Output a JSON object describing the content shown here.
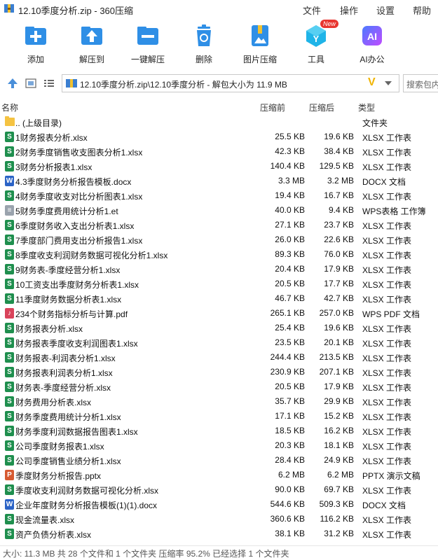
{
  "window": {
    "title": "12.10季度分析.zip - 360压缩",
    "menus": [
      "文件",
      "操作",
      "设置",
      "帮助"
    ]
  },
  "toolbar": {
    "items": [
      {
        "label": "添加",
        "icon": "add-icon"
      },
      {
        "label": "解压到",
        "icon": "extract-to-icon"
      },
      {
        "label": "一键解压",
        "icon": "one-click-extract-icon"
      },
      {
        "label": "删除",
        "icon": "trash-icon"
      },
      {
        "label": "图片压缩",
        "icon": "image-compress-icon"
      },
      {
        "label": "工具",
        "icon": "tools-icon",
        "badge": "New"
      },
      {
        "label": "AI办公",
        "icon": "ai-icon",
        "icon_text": "AI"
      }
    ]
  },
  "address": {
    "path": "12.10季度分析.zip\\12.10季度分析 - 解包大小为 11.9 MB",
    "search_placeholder": "搜索包内"
  },
  "columns": {
    "name": "名称",
    "size": "压缩前",
    "packed": "压缩后",
    "type": "类型"
  },
  "parent_row": {
    "name": ".. (上级目录)",
    "type": "文件夹"
  },
  "files": [
    {
      "name": "1财务报表分析.xlsx",
      "size": "25.5 KB",
      "packed": "19.6 KB",
      "type": "XLSX 工作表",
      "kind": "xlsx"
    },
    {
      "name": "2财务季度销售收支图表分析1.xlsx",
      "size": "42.3 KB",
      "packed": "38.4 KB",
      "type": "XLSX 工作表",
      "kind": "xlsx"
    },
    {
      "name": "3财务分析报表1.xlsx",
      "size": "140.4 KB",
      "packed": "129.5 KB",
      "type": "XLSX 工作表",
      "kind": "xlsx"
    },
    {
      "name": "4.3季度财务分析报告模板.docx",
      "size": "3.3 MB",
      "packed": "3.2 MB",
      "type": "DOCX 文档",
      "kind": "docx"
    },
    {
      "name": "4财务季度收支对比分析图表1.xlsx",
      "size": "19.4 KB",
      "packed": "16.7 KB",
      "type": "XLSX 工作表",
      "kind": "xlsx"
    },
    {
      "name": "5财务季度费用统计分析1.et",
      "size": "40.0 KB",
      "packed": "9.4 KB",
      "type": "WPS表格 工作簿",
      "kind": "et"
    },
    {
      "name": "6季度财务收入支出分析表1.xlsx",
      "size": "27.1 KB",
      "packed": "23.7 KB",
      "type": "XLSX 工作表",
      "kind": "xlsx"
    },
    {
      "name": "7季度部门费用支出分析报告1.xlsx",
      "size": "26.0 KB",
      "packed": "22.6 KB",
      "type": "XLSX 工作表",
      "kind": "xlsx"
    },
    {
      "name": "8季度收支利润财务数据可视化分析1.xlsx",
      "size": "89.3 KB",
      "packed": "76.0 KB",
      "type": "XLSX 工作表",
      "kind": "xlsx"
    },
    {
      "name": "9财务表-季度经营分析1.xlsx",
      "size": "20.4 KB",
      "packed": "17.9 KB",
      "type": "XLSX 工作表",
      "kind": "xlsx"
    },
    {
      "name": "10工资支出季度财务分析表1.xlsx",
      "size": "20.5 KB",
      "packed": "17.7 KB",
      "type": "XLSX 工作表",
      "kind": "xlsx"
    },
    {
      "name": "11季度财务数据分析表1.xlsx",
      "size": "46.7 KB",
      "packed": "42.7 KB",
      "type": "XLSX 工作表",
      "kind": "xlsx"
    },
    {
      "name": "234个财务指标分析与计算.pdf",
      "size": "265.1 KB",
      "packed": "257.0 KB",
      "type": "WPS PDF 文档",
      "kind": "pdf"
    },
    {
      "name": "财务报表分析.xlsx",
      "size": "25.4 KB",
      "packed": "19.6 KB",
      "type": "XLSX 工作表",
      "kind": "xlsx"
    },
    {
      "name": "财务报表季度收支利润图表1.xlsx",
      "size": "23.5 KB",
      "packed": "20.1 KB",
      "type": "XLSX 工作表",
      "kind": "xlsx"
    },
    {
      "name": "财务报表-利润表分析1.xlsx",
      "size": "244.4 KB",
      "packed": "213.5 KB",
      "type": "XLSX 工作表",
      "kind": "xlsx"
    },
    {
      "name": "财务报表利润表分析1.xlsx",
      "size": "230.9 KB",
      "packed": "207.1 KB",
      "type": "XLSX 工作表",
      "kind": "xlsx"
    },
    {
      "name": "财务表-季度经营分析.xlsx",
      "size": "20.5 KB",
      "packed": "17.9 KB",
      "type": "XLSX 工作表",
      "kind": "xlsx"
    },
    {
      "name": "财务费用分析表.xlsx",
      "size": "35.7 KB",
      "packed": "29.9 KB",
      "type": "XLSX 工作表",
      "kind": "xlsx"
    },
    {
      "name": "财务季度费用统计分析1.xlsx",
      "size": "17.1 KB",
      "packed": "15.2 KB",
      "type": "XLSX 工作表",
      "kind": "xlsx"
    },
    {
      "name": "财务季度利润数据报告图表1.xlsx",
      "size": "18.5 KB",
      "packed": "16.2 KB",
      "type": "XLSX 工作表",
      "kind": "xlsx"
    },
    {
      "name": "公司季度财务报表1.xlsx",
      "size": "20.3 KB",
      "packed": "18.1 KB",
      "type": "XLSX 工作表",
      "kind": "xlsx"
    },
    {
      "name": "公司季度销售业绩分析1.xlsx",
      "size": "28.4 KB",
      "packed": "24.9 KB",
      "type": "XLSX 工作表",
      "kind": "xlsx"
    },
    {
      "name": "季度财务分析报告.pptx",
      "size": "6.2 MB",
      "packed": "6.2 MB",
      "type": "PPTX 演示文稿",
      "kind": "pptx"
    },
    {
      "name": "季度收支利润财务数据可视化分析.xlsx",
      "size": "90.0 KB",
      "packed": "69.7 KB",
      "type": "XLSX 工作表",
      "kind": "xlsx"
    },
    {
      "name": "企业年度财务分析报告模板(1)(1).docx",
      "size": "544.6 KB",
      "packed": "509.3 KB",
      "type": "DOCX 文档",
      "kind": "docx"
    },
    {
      "name": "现金流量表.xlsx",
      "size": "360.6 KB",
      "packed": "116.2 KB",
      "type": "XLSX 工作表",
      "kind": "xlsx"
    },
    {
      "name": "资产负债分析表.xlsx",
      "size": "38.1 KB",
      "packed": "31.2 KB",
      "type": "XLSX 工作表",
      "kind": "xlsx"
    }
  ],
  "icon_colors": {
    "xlsx": "#1f8f4e",
    "docx": "#2b63c6",
    "pdf": "#d9435a",
    "pptx": "#d65a31",
    "et": "#9aa3ad"
  },
  "icon_glyphs": {
    "xlsx": "S",
    "docx": "W",
    "pdf": "♪",
    "pptx": "P",
    "et": "≡"
  },
  "status": "大小: 11.3 MB 共 28 个文件和 1 个文件夹 压缩率 95.2% 已经选择 1 个文件夹"
}
